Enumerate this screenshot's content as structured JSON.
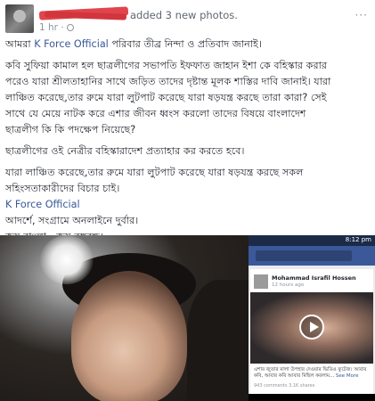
{
  "header": {
    "action_text": "added 3 new photos.",
    "time": "1 hr ·",
    "more": "···"
  },
  "body": {
    "p1_prefix": "আমরা ",
    "p1_link": "K Force Official",
    "p1_suffix": " পরিবার তীব্র নিন্দা ও প্রতিবাদ জানাই।",
    "p2_lines": [
      "কবি সুফিয়া কামাল হল ছাত্রলীগের সভাপতি ইফফাত জাহান ইশা কে বহিস্কার করার",
      "পরেও যারা শ্রীলতাহানির সাথে জড়িত তাদের দৃষ্টান্ত মূলক শাস্তির দাবি জানাই। যারা",
      "লাঞ্চিত করেছে,তার রুমে যারা লুটপাট করেছে যারা ষড়যন্ত্র করছে তারা কারা? সেই",
      "সাথে যে মেয়ে নাটক করে এশার জীবন ধ্বংস করলো তাদের বিষয়ে বাংলাদেশ",
      "ছাত্রলীগ কি কি পদক্ষেপ নিয়েছে?"
    ],
    "p3": "ছাত্রলীগের ওই নেত্রীর বহিস্কারাদেশ প্রত্যাহার কর করতে হবে।",
    "p4_lines": [
      "যারা লাঞ্চিত করেছে,তার রুমে যারা লুটপাট করেছে যারা ষড়যন্ত্র করছে সকল",
      "সহিংসতাকারীদের বিচার চাই।"
    ],
    "sign_link": "K Force Official",
    "sign_line1": "আদর্শে, সংগ্রামে অনলাইনে দুর্বার।",
    "sign_line2": "জয় বাংলা - জয় বঙ্গবন্ধু।"
  },
  "phone": {
    "status_time": "8:12 pm",
    "post_name": "Mohammad Israfil Hossen",
    "post_time": "12 hours ago",
    "caption": "এশার জুতার মালা উপহার দেওয়ার ভিডিও ফুটেজ। আবার কবি, আবার কবি আবার মিছিল করলাম...",
    "see_more": "See More",
    "stats": "943 comments  3.1K shares"
  }
}
